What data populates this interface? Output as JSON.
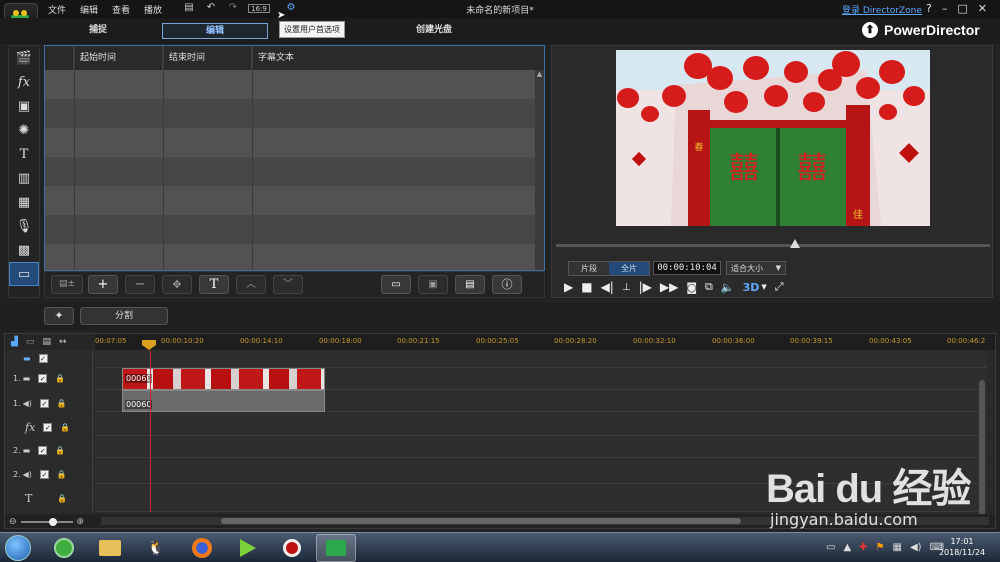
{
  "menubar": {
    "menus": [
      "文件",
      "编辑",
      "查看",
      "播放"
    ],
    "project_title": "未命名的新项目*",
    "login_link": "登录 DirectorZone",
    "tooltip": "设置用户首选项",
    "aspect": "16:9",
    "help": "?",
    "minimize": "–",
    "maximize": "□",
    "close": "✕"
  },
  "modes": {
    "capture": "捕捉",
    "edit": "编辑",
    "disc": "创建光盘",
    "brand": "PowerDirector"
  },
  "subtitle_room": {
    "columns": [
      "起始时间",
      "结束时间",
      "字幕文本"
    ],
    "rows": 7
  },
  "preview": {
    "clip_label": "片段",
    "movie_label": "全片",
    "timecode": "00:00:10:04",
    "fit_label": "适合大小",
    "three_d": "3D",
    "scrub_position": 0.55,
    "video_text_1": "囍",
    "video_text_2": "囍",
    "couplet_1": "春",
    "couplet_2": "佳"
  },
  "splitrow": {
    "split_label": "分割"
  },
  "timeline": {
    "ruler_ticks": [
      "00:07:05",
      "00:00:10:20",
      "00:00:14:10",
      "00:00:18:00",
      "00:00:21:15",
      "00:00:25:05",
      "00:00:28:20",
      "00:00:32:10",
      "00:00:36:00",
      "00:00:39:15",
      "00:00:43:05",
      "00:00:46:2"
    ],
    "tracks": [
      {
        "label": "",
        "icon": "video-icon"
      },
      {
        "label": "1.",
        "icon": "video-icon"
      },
      {
        "label": "1.",
        "icon": "audio-icon"
      },
      {
        "label": "",
        "icon": "fx-icon"
      },
      {
        "label": "2.",
        "icon": "video-icon"
      },
      {
        "label": "2.",
        "icon": "audio-icon"
      },
      {
        "label": "",
        "icon": "title-icon"
      }
    ],
    "video_clip_name": "00060",
    "audio_clip_name": "00060",
    "fx_label": "fx",
    "title_label": "T"
  },
  "taskbar": {
    "time": "17:01",
    "date": "2018/11/24"
  },
  "watermark": {
    "logo": "Bai du 经验",
    "url": "jingyan.baidu.com"
  },
  "colors": {
    "accent": "#5aa8ff",
    "active_tab_border": "#7aa7d8",
    "playhead": "#c42a2a",
    "clip_red": "#c01818"
  }
}
